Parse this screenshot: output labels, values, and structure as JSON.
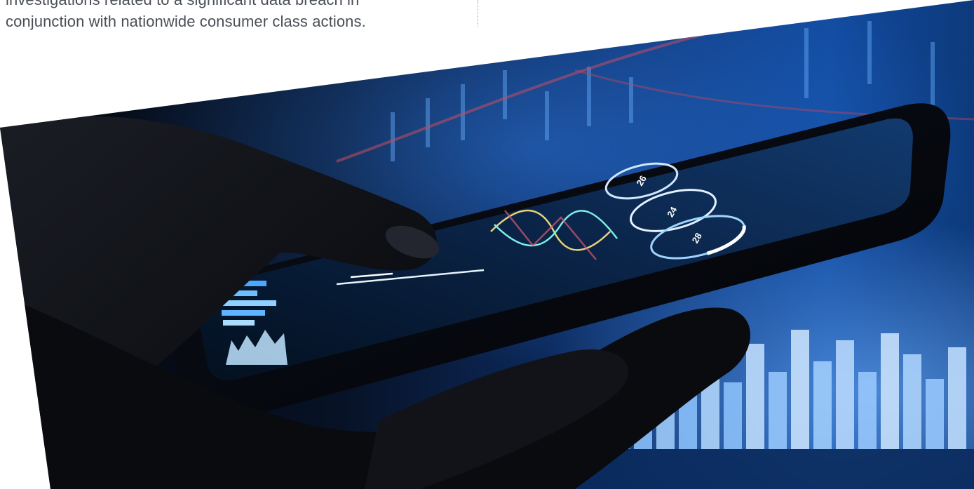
{
  "article": {
    "caption_line1": "investigations related to a significant data breach in",
    "caption_line2": "conjunction with nationwide consumer class actions."
  },
  "hero": {
    "screen_badge_1": "26",
    "screen_badge_2": "24",
    "screen_badge_3": "28"
  },
  "colors": {
    "text": "#4a4f57",
    "divider": "#9aa6b2",
    "photo_dark": "#05070d",
    "photo_blue": "#1a6fe0",
    "photo_accent": "#c44d63"
  }
}
